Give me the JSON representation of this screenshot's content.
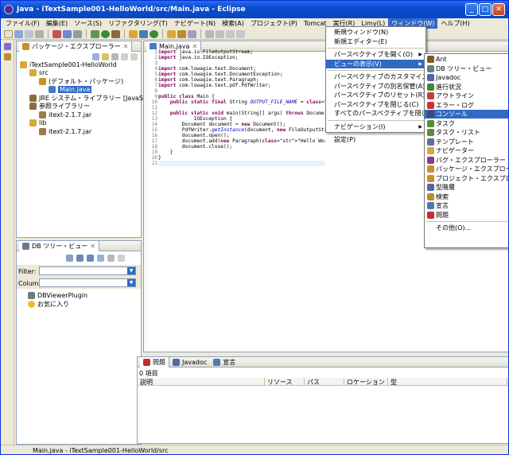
{
  "window": {
    "title": "Java - iTextSample001-HelloWorld/src/Main.java - Eclipse"
  },
  "title_buttons": {
    "minimize": "_",
    "maximize": "□",
    "close": "✕"
  },
  "menubar": [
    "ファイル(F)",
    "編集(E)",
    "ソース(S)",
    "リファクタリング(T)",
    "ナビゲート(N)",
    "検索(A)",
    "プロジェクト(P)",
    "Tomcat",
    "実行(R)",
    "Limy(L)",
    "ウィンドウ(W)",
    "ヘルプ(H)"
  ],
  "active_menu": "ウィンドウ(W)",
  "package_explorer": {
    "tab_label": "パッケージ・エクスプローラー",
    "tree": [
      {
        "label": "iTextSample001-HelloWorld",
        "icon": "project-icon",
        "color": "#d8a93a"
      },
      {
        "label": "src",
        "icon": "folder-icon",
        "color": "#d8a93a"
      },
      {
        "label": "(デフォルト・パッケージ)",
        "icon": "package-icon",
        "color": "#c98f2b"
      },
      {
        "label": "Main.java",
        "icon": "java-file-icon",
        "color": "#4878c8",
        "selected": true
      },
      {
        "label": "JRE システム・ライブラリー [JavaSE-1.6]",
        "icon": "library-icon",
        "color": "#8a6d3b"
      },
      {
        "label": "参照ライブラリー",
        "icon": "library-icon",
        "color": "#8a6d3b"
      },
      {
        "label": "itext-2.1.7.jar",
        "icon": "jar-icon",
        "color": "#a07a46"
      },
      {
        "label": "lib",
        "icon": "folder-icon",
        "color": "#d8a93a"
      },
      {
        "label": "itext-2.1.7.jar",
        "icon": "jar-icon",
        "color": "#a07a46"
      }
    ]
  },
  "db_tree": {
    "tab_label": "DB ツリー・ビュー",
    "filter_label": "Filter:",
    "column_label": "Column:",
    "items": [
      {
        "label": "DBViewerPlugin",
        "icon": "database-icon"
      },
      {
        "label": "お気に入り",
        "icon": "star-icon"
      }
    ]
  },
  "editor": {
    "tab_label": "Main.java",
    "lines": [
      "import java.io.FileOutputStream;",
      "import java.io.IOException;",
      "",
      "import com.lowagie.text.Document;",
      "import com.lowagie.text.DocumentException;",
      "import com.lowagie.text.Paragraph;",
      "import com.lowagie.text.pdf.PdfWriter;",
      "",
      "public class Main {",
      "    public static final String OUTPUT_FILE_NAME = \"hello",
      "",
      "    public static void main(String[] args) throws Docume",
      "            IOException {",
      "        Document document = new Document();",
      "        PdfWriter.getInstance(document, new FileOutputStre",
      "        document.open();",
      "        document.add(new Paragraph(\"Hello World!\"));",
      "        document.close();",
      "    }",
      "}",
      ""
    ],
    "line_numbers": [
      "1",
      "2",
      "3",
      "4",
      "5",
      "6",
      "7",
      "8",
      "9",
      "10",
      "11",
      "12",
      "13",
      "14",
      "15",
      "16",
      "17",
      "18",
      "19",
      "20",
      "21"
    ]
  },
  "window_menu": {
    "items": [
      {
        "label": "新規ウィンドウ(N)"
      },
      {
        "label": "新規エディター(E)"
      },
      {
        "sep": true
      },
      {
        "label": "パースペクティブを開く(O)",
        "submenu": true
      },
      {
        "label": "ビューの表示(V)",
        "submenu": true,
        "highlighted": true
      },
      {
        "sep": true
      },
      {
        "label": "パースペクティブのカスタマイズ(Z)..."
      },
      {
        "label": "パースペクティブの別名保管(A)..."
      },
      {
        "label": "パースペクティブのリセット(R)..."
      },
      {
        "label": "パースペクティブを閉じる(C)"
      },
      {
        "label": "すべてのパースペクティブを閉じる(L)"
      },
      {
        "sep": true
      },
      {
        "label": "ナビゲーション(I)",
        "submenu": true
      },
      {
        "sep": true
      },
      {
        "label": "設定(P)"
      }
    ]
  },
  "view_submenu": {
    "items": [
      {
        "label": "Ant",
        "icon": "ant-icon",
        "color": "#7a5a2a"
      },
      {
        "label": "DB ツリー・ビュー",
        "icon": "db-tree-icon",
        "color": "#6c7a8a"
      },
      {
        "label": "Javadoc",
        "icon": "javadoc-icon",
        "color": "#5068a8"
      },
      {
        "label": "進行状況",
        "icon": "progress-icon",
        "color": "#3a8a3a"
      },
      {
        "label": "アウトライン",
        "icon": "outline-icon",
        "color": "#c04040"
      },
      {
        "label": "エラー・ログ",
        "icon": "error-log-icon",
        "color": "#d03030"
      },
      {
        "label": "コンソール",
        "icon": "console-icon",
        "color": "#3a4a7a",
        "highlighted": true
      },
      {
        "label": "タスク",
        "icon": "task-icon",
        "color": "#5a8a3a"
      },
      {
        "label": "タスク・リスト",
        "icon": "task-list-icon",
        "color": "#5a8a3a"
      },
      {
        "label": "テンプレート",
        "icon": "template-icon",
        "color": "#6a6a9a"
      },
      {
        "label": "ナビゲーター",
        "icon": "navigator-icon",
        "color": "#d8a93a"
      },
      {
        "label": "バグ・エクスプローラー",
        "icon": "bug-icon",
        "color": "#8a3a8a"
      },
      {
        "label": "パッケージ・エクスプローラー",
        "icon": "package-explorer-icon",
        "color": "#c98f2b"
      },
      {
        "label": "プロジェクト・エクスプローラー",
        "icon": "project-explorer-icon",
        "color": "#c98f2b"
      },
      {
        "label": "型階層",
        "icon": "type-hierarchy-icon",
        "color": "#5068a8"
      },
      {
        "label": "検索",
        "icon": "search-icon",
        "color": "#c08a2a"
      },
      {
        "label": "宣言",
        "icon": "declaration-icon",
        "color": "#4a7ab8"
      },
      {
        "label": "問題",
        "icon": "problems-icon",
        "color": "#c03030"
      },
      {
        "sep": true
      },
      {
        "label": "その他(O)..."
      }
    ]
  },
  "bottom_panel": {
    "tabs": [
      {
        "label": "問題",
        "icon": "problems-icon"
      },
      {
        "label": "Javadoc",
        "icon": "javadoc-icon"
      },
      {
        "label": "宣言",
        "icon": "declaration-icon"
      }
    ],
    "count": "0 項目",
    "columns": [
      "説明",
      "リソース",
      "パス",
      "ロケーション",
      "型"
    ]
  },
  "status_bar": {
    "text": "Main.java - iTextSample001-HelloWorld/src"
  }
}
